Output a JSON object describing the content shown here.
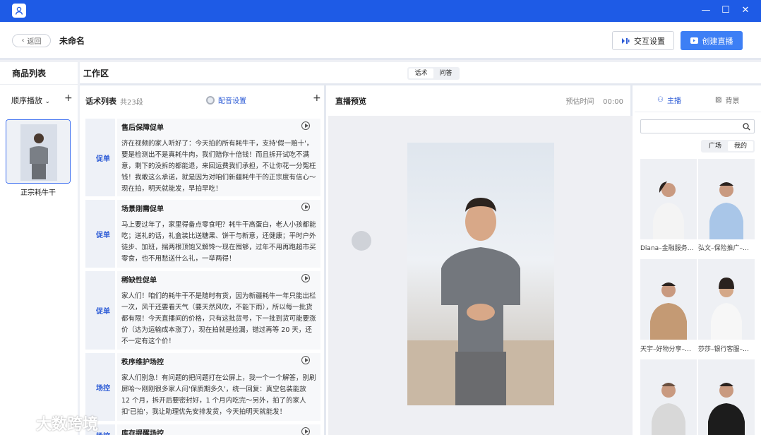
{
  "header": {
    "back_label": "返回",
    "title": "未命名",
    "interact_label": "交互设置",
    "create_label": "创建直播"
  },
  "products": {
    "title": "商品列表",
    "order_label": "顺序播放",
    "add": "+",
    "items": [
      {
        "name": "正宗耗牛干"
      }
    ]
  },
  "workspace": {
    "title": "工作区",
    "tabs": [
      "话术",
      "问答"
    ],
    "active_tab": "话术"
  },
  "scripts": {
    "title": "话术列表",
    "count": "共23段",
    "voice_label": "配音设置",
    "add": "+",
    "items": [
      {
        "tag": "促单",
        "title": "售后保障促单",
        "text": "济在视频的家人听好了：今天拍的所有耗牛干，支持'假一赔十'，要是检测出不是真耗牛肉，我们赔你十倍钱！而且拆开试吃不满意，剩下的没拆的都能退，来回运费我们承担，不让你花一分冤枉钱！我敢这么承诺，就是因为对咱们新疆耗牛干的正宗度有信心～现在拍，明天就能发，早拍早吃！"
      },
      {
        "tag": "促单",
        "title": "场景刚需促单",
        "text": "马上要过年了，家里得备点零食吧？耗牛干高蛋白，老人小孩都能吃；送礼的话，礼盒装比送糖果、饼干与新意，还健康；平时户外徒步、加班，揣两根顶饱又解馋～现在囤够，过年不用再跑超市买零食，也不用愁送什么礼，一举两得！"
      },
      {
        "tag": "促单",
        "title": "稀缺性促单",
        "text": "家人们！咱们的耗牛干不是随时有货，因为新疆耗牛一年只能出栏一次，风干还要看天气（要天然风吹，不能下雨），所以每一批货都有限！今天直播间的价格，只有这批货号，下一批到货可能要涨价（达为运输成本涨了），现在拍就是捡漏，错过再等 20 天，还不一定有这个价！"
      },
      {
        "tag": "场控",
        "title": "秩序维护场控",
        "text": "家人们别急！有问题的把问题打在公屏上，我一个一个解答，别刷屏哈～刚刚很多家人问'保质期多久'，统一回复：真空包装能放 12 个月，拆开后要密封好，1 个月内吃完～另外，拍了的家人扣'已拍'，我让助理优先安排发货，今天拍明天就能发！"
      },
      {
        "tag": "场控",
        "title": "库存提醒场控",
        "text": ""
      }
    ]
  },
  "preview": {
    "title": "直播预览",
    "time_label": "预估时间",
    "time_value": "00:00"
  },
  "anchors": {
    "tabs": [
      "主播",
      "背景"
    ],
    "active_tab": "主播",
    "search_placeholder": "",
    "filters": [
      "广场",
      "我的"
    ],
    "active_filter": "我的",
    "items": [
      {
        "name": "Diana–金融服务…"
      },
      {
        "name": "弘文–保险推广–…"
      },
      {
        "name": "天宇–好物分享–…"
      },
      {
        "name": "莎莎–银行客服–…"
      },
      {
        "name": ""
      },
      {
        "name": ""
      }
    ]
  },
  "watermark": {
    "text": "大数跨境"
  },
  "colors": {
    "titlebar": "#1e5be6",
    "accent": "#3d7ff5",
    "tag": "#2c5bd6"
  }
}
